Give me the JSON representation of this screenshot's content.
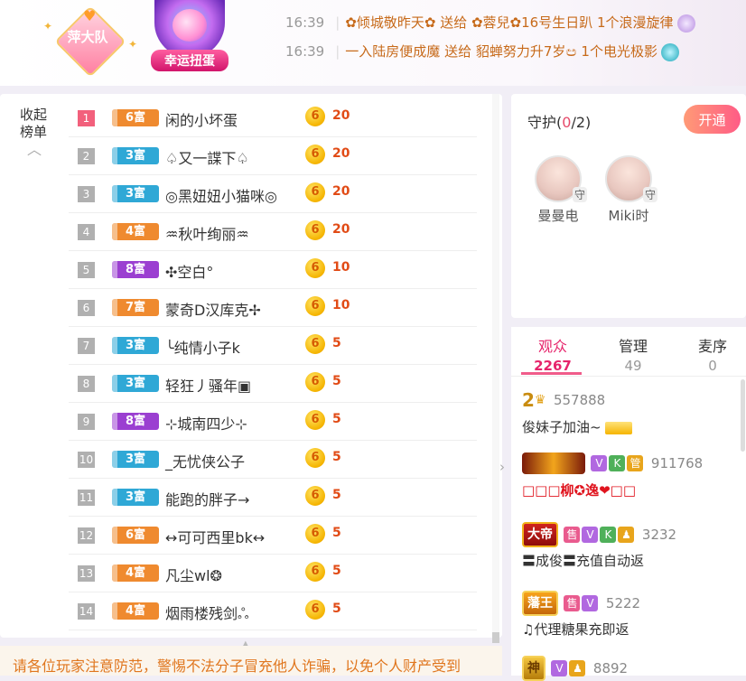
{
  "header": {
    "fan_group": "萍大队",
    "lucky_egg_label": "幸运扭蛋",
    "gifts": [
      {
        "time": "16:39",
        "text": "✿倾城敬昨天✿ 送给 ✿蓉兒✿16号生日趴 1个浪漫旋律"
      },
      {
        "time": "16:39",
        "text": "一入陆房便成魔 送给 貂蝉努力升7岁ඏ 1个电光极影"
      }
    ]
  },
  "rank": {
    "collapse_label": "收起榜单",
    "rows": [
      {
        "rank": "1",
        "level": "6富",
        "name": "闲的小坏蛋",
        "score": "20",
        "color": "#ef8a2f"
      },
      {
        "rank": "2",
        "level": "3富",
        "name": "♤又一諜下♤",
        "score": "20",
        "color": "#2fa8d6"
      },
      {
        "rank": "3",
        "level": "3富",
        "name": "◎黑妞妞小猫咪◎",
        "score": "20",
        "color": "#2fa8d6"
      },
      {
        "rank": "4",
        "level": "4富",
        "name": "♒秋叶绚丽♒",
        "score": "20",
        "color": "#ef8a2f"
      },
      {
        "rank": "5",
        "level": "8富",
        "name": "✣空白°",
        "score": "10",
        "color": "#9b3fd1"
      },
      {
        "rank": "6",
        "level": "7富",
        "name": "蒙奇D汉库克✢",
        "score": "10",
        "color": "#ef8a2f"
      },
      {
        "rank": "7",
        "level": "3富",
        "name": "╰纯情小子k",
        "score": "5",
        "color": "#2fa8d6"
      },
      {
        "rank": "8",
        "level": "3富",
        "name": "轻狂丿骚年▣",
        "score": "5",
        "color": "#2fa8d6"
      },
      {
        "rank": "9",
        "level": "8富",
        "name": "⊹城南四少⊹",
        "score": "5",
        "color": "#9b3fd1"
      },
      {
        "rank": "10",
        "level": "3富",
        "name": "_无忧侠公子",
        "score": "5",
        "color": "#2fa8d6"
      },
      {
        "rank": "11",
        "level": "3富",
        "name": "能跑的胖子→",
        "score": "5",
        "color": "#2fa8d6"
      },
      {
        "rank": "12",
        "level": "6富",
        "name": "↔可可西里bk↔",
        "score": "5",
        "color": "#ef8a2f"
      },
      {
        "rank": "13",
        "level": "4富",
        "name": "凡尘wl❂",
        "score": "5",
        "color": "#ef8a2f"
      },
      {
        "rank": "14",
        "level": "4富",
        "name": "烟雨楼残剑ஃ",
        "score": "5",
        "color": "#ef8a2f"
      }
    ],
    "coin_glyph": "6"
  },
  "notice": "请各位玩家注意防范，警惕不法分子冒充他人诈骗，以免个人财产受到",
  "guard": {
    "title": "守护",
    "count": "0",
    "total": "/2",
    "open_button": "开通",
    "members": [
      {
        "name": "曼曼电",
        "badge": "守"
      },
      {
        "name": "Miki时",
        "badge": "守"
      }
    ]
  },
  "audience": {
    "tabs": [
      {
        "label": "观众",
        "count": "2267"
      },
      {
        "label": "管理",
        "count": "49"
      },
      {
        "label": "麦序",
        "count": "0"
      }
    ],
    "users": [
      {
        "crest": "2",
        "uid": "557888",
        "msg": "俊妹子加油~"
      },
      {
        "crest": "",
        "tags": [
          "V",
          "K",
          "管"
        ],
        "uid": "911768",
        "msg": "□□□柳✪逸❤□□"
      },
      {
        "crest": "大帝",
        "tags": [
          "售",
          "V",
          "K",
          "♟"
        ],
        "uid": "3232",
        "msg": "〓成俊〓充值自动返"
      },
      {
        "crest": "藩王",
        "tags": [
          "售",
          "V"
        ],
        "uid": "5222",
        "msg": "♫代理糖果充即返"
      },
      {
        "crest": "神",
        "tags": [
          "V",
          "♟"
        ],
        "uid": "8892",
        "msg": ""
      }
    ]
  },
  "colors": {
    "accent_pink": "#e6246b",
    "score_red": "#e14b16",
    "notice_orange": "#e0761e"
  }
}
